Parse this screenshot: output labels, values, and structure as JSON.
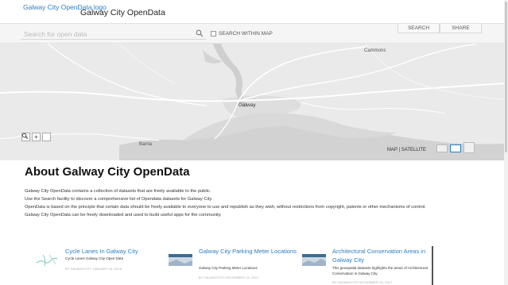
{
  "header": {
    "logo_alt": "Galway City OpenData logo",
    "title": "Galway City OpenData"
  },
  "search": {
    "placeholder": "Search for open data",
    "within_map_label": "SEARCH WITHIN MAP",
    "within_map_checked": false
  },
  "tabs": [
    {
      "label": "SEARCH"
    },
    {
      "label": "SHARE"
    }
  ],
  "map": {
    "labels": {
      "cammons": "Cammons",
      "galway": "Galway",
      "barna": "Barna"
    },
    "zoom_out": "–",
    "zoom_in": "+",
    "search_icon": "magnifier-icon",
    "mode_toggle": "MAP | SATELLITE",
    "colors": {
      "land": "#eaeaea",
      "water": "#cfcfcf",
      "roads": "#ffffff"
    }
  },
  "about": {
    "title": "About Galway City OpenData",
    "paragraphs": [
      "Galway City OpenData contains a collection of datasets that are freely available to the public.",
      "Use the Search facility to discover a comprehensive list of Opendata datasets for Galway City.",
      "OpenData is based on the principle that certain data should be freely available to everyone to use and republish as they wish, without restrictions from copyright, patents or other mechanisms of control.",
      "Galway City OpenData can be freely downloaded and used to build useful apps for the community."
    ]
  },
  "cards": [
    {
      "title": "Cycle Lanes In Galway City",
      "description": "Cycle Lanes Galway City Open Data",
      "meta": "BY GALWAYCITY JANUARY 18, 2018"
    },
    {
      "title": "Galway City Parking Meter Locations",
      "description": "Galway City Parking Meter Locations",
      "meta": "BY GALWAYCITY NOVEMBER 14, 2017"
    },
    {
      "title": "Architectural Conservation Areas in Galway City",
      "description": "This geospatial datasets highlights the areas of Architectural Conservation in Galway City.",
      "meta": "BY GALWAYCITY NOVEMBER 14, 2017"
    }
  ],
  "accent_color": "#2a7fc4"
}
